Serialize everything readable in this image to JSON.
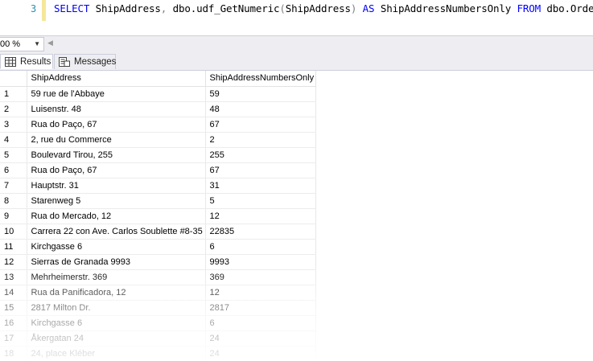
{
  "editor": {
    "line_number": "3",
    "tokens": {
      "select": "SELECT",
      "col1": "ShipAddress",
      "comma": ",",
      "func": "dbo.udf_GetNumeric",
      "lparen": "(",
      "arg": "ShipAddress",
      "rparen": ")",
      "as": "AS",
      "alias": "ShipAddressNumbersOnly",
      "from": "FROM",
      "table": "dbo.Orders",
      "semicolon": ";"
    }
  },
  "zoom": {
    "value": "00 %"
  },
  "tabs": [
    {
      "label": "Results",
      "icon": "grid-icon",
      "active": true
    },
    {
      "label": "Messages",
      "icon": "messages-icon",
      "active": false
    }
  ],
  "grid": {
    "columns": [
      "",
      "ShipAddress",
      "ShipAddressNumbersOnly"
    ],
    "rows": [
      [
        "1",
        "59 rue de l'Abbaye",
        "59"
      ],
      [
        "2",
        "Luisenstr. 48",
        "48"
      ],
      [
        "3",
        "Rua do Paço, 67",
        "67"
      ],
      [
        "4",
        "2, rue du Commerce",
        "2"
      ],
      [
        "5",
        "Boulevard Tirou, 255",
        "255"
      ],
      [
        "6",
        "Rua do Paço, 67",
        "67"
      ],
      [
        "7",
        "Hauptstr. 31",
        "31"
      ],
      [
        "8",
        "Starenweg 5",
        "5"
      ],
      [
        "9",
        "Rua do Mercado, 12",
        "12"
      ],
      [
        "10",
        "Carrera 22 con Ave. Carlos Soublette #8-35",
        "22835"
      ],
      [
        "11",
        "Kirchgasse 6",
        "6"
      ],
      [
        "12",
        "Sierras de Granada 9993",
        "9993"
      ],
      [
        "13",
        "Mehrheimerstr. 369",
        "369"
      ],
      [
        "14",
        "Rua da Panificadora, 12",
        "12"
      ],
      [
        "15",
        "2817 Milton Dr.",
        "2817"
      ],
      [
        "16",
        "Kirchgasse 6",
        "6"
      ],
      [
        "17",
        "Åkergatan 24",
        "24"
      ],
      [
        "18",
        "24, place Kléber",
        "24"
      ]
    ]
  }
}
